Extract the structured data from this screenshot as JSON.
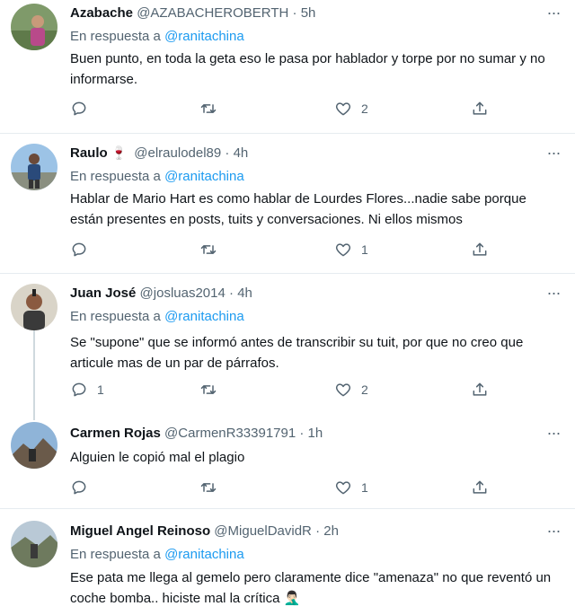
{
  "reply_prefix": "En respuesta a",
  "tweets": [
    {
      "name": "Azabache",
      "handle": "@AZABACHEROBERTH",
      "sep": "·",
      "time": "5h",
      "reply_to": "@ranitachina",
      "text": "Buen punto, en toda la geta eso le pasa por hablador y torpe por no sumar y no informarse.",
      "replies": "",
      "retweets": "",
      "likes": "2"
    },
    {
      "name": "Raulo",
      "name_emoji": "🍷",
      "handle": "@elraulodel89",
      "sep": "·",
      "time": "4h",
      "reply_to": "@ranitachina",
      "text": "Hablar de Mario Hart es como hablar de Lourdes Flores...nadie sabe porque están presentes en posts, tuits y conversaciones. Ni ellos mismos",
      "replies": "",
      "retweets": "",
      "likes": "1"
    },
    {
      "name": "Juan José",
      "handle": "@josluas2014",
      "sep": "·",
      "time": "4h",
      "reply_to": "@ranitachina",
      "text": "Se \"supone\" que se informó antes de transcribir su tuit, por que no creo que articule mas de un par de párrafos.",
      "replies": "1",
      "retweets": "",
      "likes": "2"
    },
    {
      "name": "Carmen Rojas",
      "handle": "@CarmenR33391791",
      "sep": "·",
      "time": "1h",
      "text": "Alguien le copió mal el plagio",
      "replies": "",
      "retweets": "",
      "likes": "1"
    },
    {
      "name": "Miguel Angel Reinoso",
      "handle": "@MiguelDavidR",
      "sep": "·",
      "time": "2h",
      "reply_to": "@ranitachina",
      "text": "Ese pata me llega al gemelo pero claramente dice \"amenaza\" no que reventó un coche bomba.. hiciste mal la crítica 🤦🏻‍♂️"
    }
  ],
  "icons": {
    "reply": "reply-icon",
    "retweet": "retweet-icon",
    "like": "heart-icon",
    "share": "share-icon",
    "more": "more-options-icon"
  },
  "colors": {
    "link": "#1d9bf0",
    "secondary_text": "#536471",
    "divider": "#e6ecf0"
  }
}
